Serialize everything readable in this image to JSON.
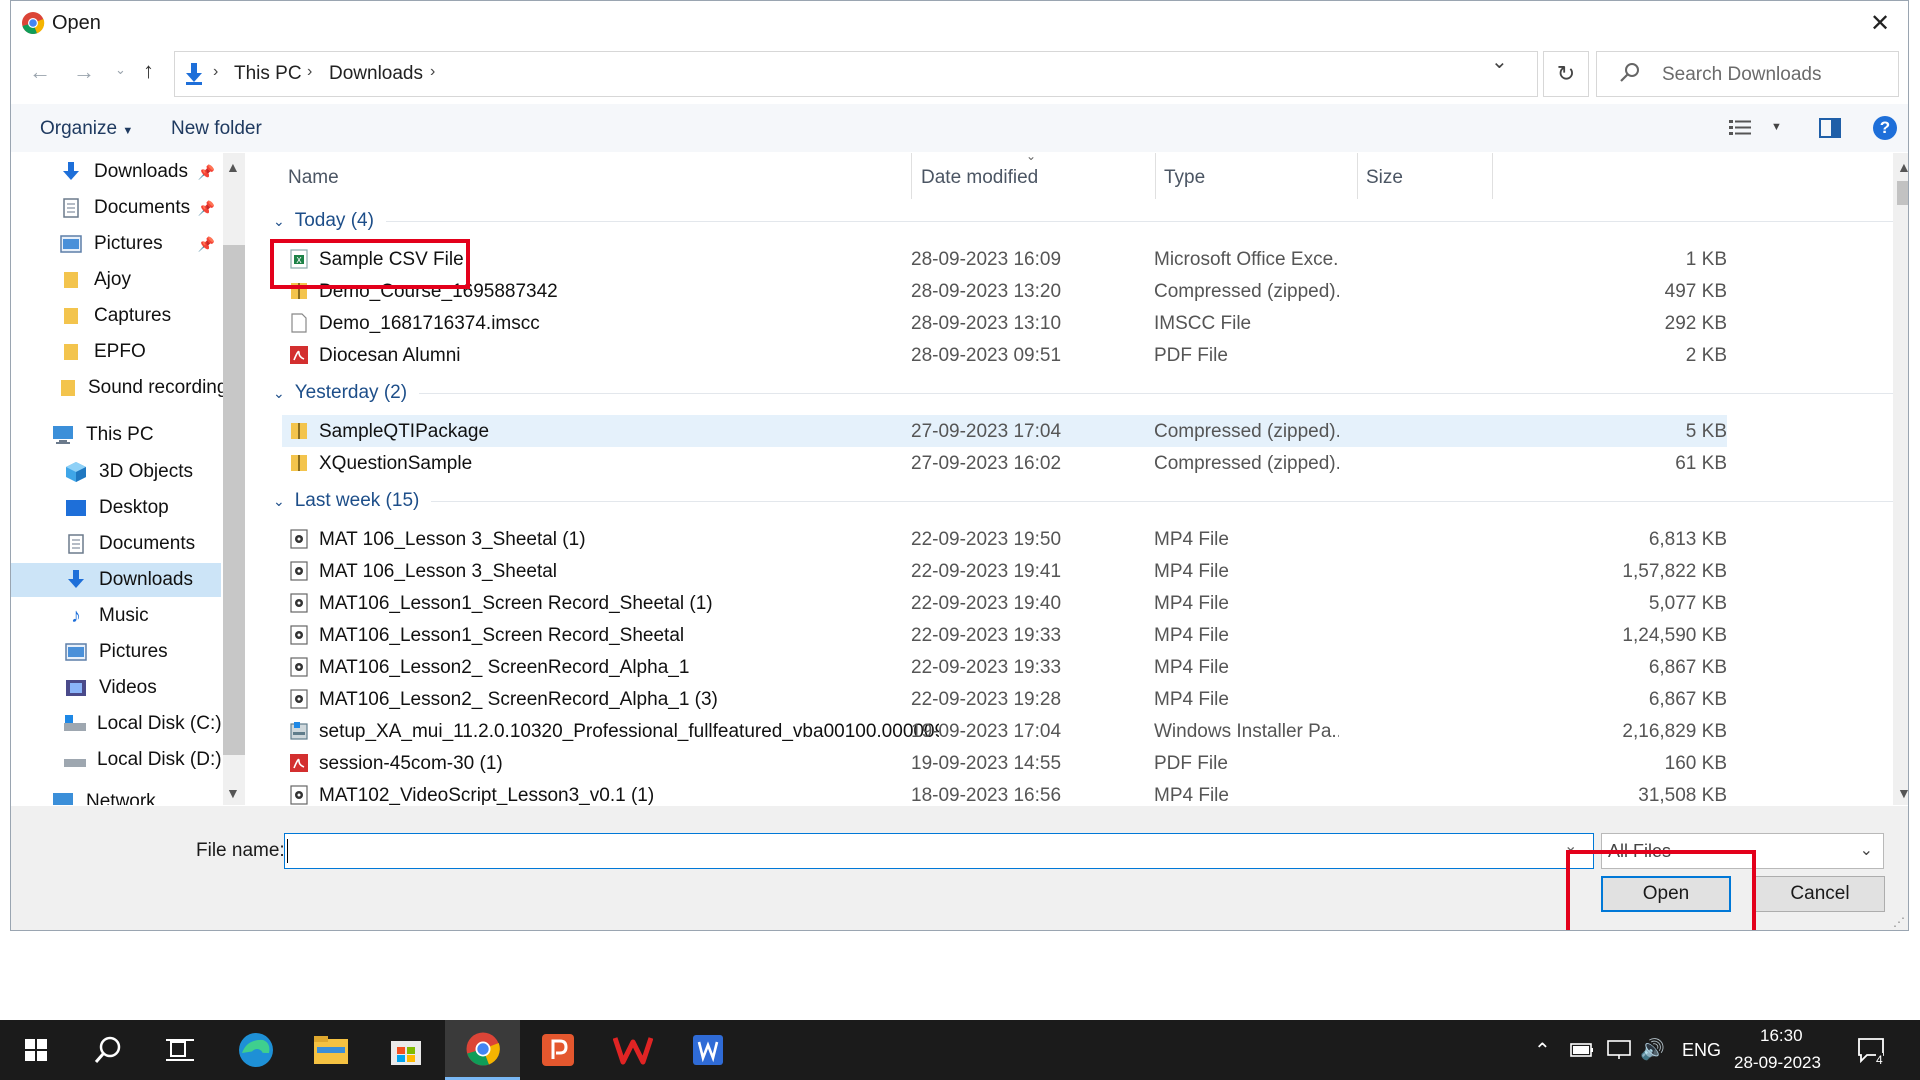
{
  "dialog": {
    "title": "Open",
    "close": "✕"
  },
  "address": {
    "crumbs": [
      "This PC",
      "Downloads"
    ],
    "search_placeholder": "Search Downloads"
  },
  "toolbar": {
    "organize": "Organize",
    "new_folder": "New folder",
    "help": "?"
  },
  "nav": {
    "items": [
      {
        "label": "Downloads",
        "icon": "download-arrow-icon",
        "pinned": true
      },
      {
        "label": "Documents",
        "icon": "document-icon",
        "pinned": true
      },
      {
        "label": "Pictures",
        "icon": "pictures-icon",
        "pinned": true
      },
      {
        "label": "Ajoy",
        "icon": "folder-icon"
      },
      {
        "label": "Captures",
        "icon": "folder-icon"
      },
      {
        "label": "EPFO",
        "icon": "folder-icon"
      },
      {
        "label": "Sound recording",
        "icon": "folder-icon"
      },
      {
        "label": "This PC",
        "icon": "pc-icon"
      },
      {
        "label": "3D Objects",
        "icon": "3d-objects-icon"
      },
      {
        "label": "Desktop",
        "icon": "desktop-icon"
      },
      {
        "label": "Documents",
        "icon": "document-icon"
      },
      {
        "label": "Downloads",
        "icon": "download-arrow-icon",
        "selected": true
      },
      {
        "label": "Music",
        "icon": "music-icon"
      },
      {
        "label": "Pictures",
        "icon": "pictures-icon"
      },
      {
        "label": "Videos",
        "icon": "videos-icon"
      },
      {
        "label": "Local Disk (C:)",
        "icon": "disk-icon"
      },
      {
        "label": "Local Disk (D:)",
        "icon": "disk-icon"
      },
      {
        "label": "Network",
        "icon": "network-icon"
      }
    ]
  },
  "columns": {
    "name": "Name",
    "date": "Date modified",
    "type": "Type",
    "size": "Size"
  },
  "groups": [
    {
      "label": "Today (4)",
      "files": [
        {
          "name": "Sample CSV File",
          "date": "28-09-2023 16:09",
          "type": "Microsoft Office Exce...",
          "size": "1 KB",
          "icon": "excel-csv-icon"
        },
        {
          "name": "Demo_Course_1695887342",
          "date": "28-09-2023 13:20",
          "type": "Compressed (zipped)...",
          "size": "497 KB",
          "icon": "zip-folder-icon"
        },
        {
          "name": "Demo_1681716374.imscc",
          "date": "28-09-2023 13:10",
          "type": "IMSCC File",
          "size": "292 KB",
          "icon": "blank-file-icon"
        },
        {
          "name": "Diocesan Alumni",
          "date": "28-09-2023 09:51",
          "type": "PDF File",
          "size": "2 KB",
          "icon": "pdf-icon"
        }
      ]
    },
    {
      "label": "Yesterday (2)",
      "files": [
        {
          "name": "SampleQTIPackage",
          "date": "27-09-2023 17:04",
          "type": "Compressed (zipped)...",
          "size": "5 KB",
          "icon": "zip-folder-icon",
          "highlight": true
        },
        {
          "name": "XQuestionSample",
          "date": "27-09-2023 16:02",
          "type": "Compressed (zipped)...",
          "size": "61 KB",
          "icon": "zip-folder-icon"
        }
      ]
    },
    {
      "label": "Last week (15)",
      "files": [
        {
          "name": "MAT 106_Lesson 3_Sheetal (1)",
          "date": "22-09-2023 19:50",
          "type": "MP4 File",
          "size": "6,813 KB",
          "icon": "video-file-icon"
        },
        {
          "name": "MAT 106_Lesson 3_Sheetal",
          "date": "22-09-2023 19:41",
          "type": "MP4 File",
          "size": "1,57,822 KB",
          "icon": "video-file-icon"
        },
        {
          "name": "MAT106_Lesson1_Screen Record_Sheetal (1)",
          "date": "22-09-2023 19:40",
          "type": "MP4 File",
          "size": "5,077 KB",
          "icon": "video-file-icon"
        },
        {
          "name": "MAT106_Lesson1_Screen Record_Sheetal",
          "date": "22-09-2023 19:33",
          "type": "MP4 File",
          "size": "1,24,590 KB",
          "icon": "video-file-icon"
        },
        {
          "name": "MAT106_Lesson2_ ScreenRecord_Alpha_1",
          "date": "22-09-2023 19:33",
          "type": "MP4 File",
          "size": "6,867 KB",
          "icon": "video-file-icon"
        },
        {
          "name": "MAT106_Lesson2_ ScreenRecord_Alpha_1 (3)",
          "date": "22-09-2023 19:28",
          "type": "MP4 File",
          "size": "6,867 KB",
          "icon": "video-file-icon"
        },
        {
          "name": "setup_XA_mui_11.2.0.10320_Professional_fullfeatured_vba00100.000009...",
          "date": "19-09-2023 17:04",
          "type": "Windows Installer Pa...",
          "size": "2,16,829 KB",
          "icon": "installer-icon"
        },
        {
          "name": "session-45com-30 (1)",
          "date": "19-09-2023 14:55",
          "type": "PDF File",
          "size": "160 KB",
          "icon": "pdf-icon"
        },
        {
          "name": "MAT102_VideoScript_Lesson3_v0.1 (1)",
          "date": "18-09-2023 16:56",
          "type": "MP4 File",
          "size": "31,508 KB",
          "icon": "video-file-icon"
        }
      ]
    }
  ],
  "bottom": {
    "filename_label": "File name:",
    "filename_value": "",
    "filter_value": "All Files",
    "open": "Open",
    "cancel": "Cancel"
  },
  "taskbar": {
    "apps": [
      "start-icon",
      "search-icon",
      "task-view-icon",
      "edge-icon",
      "file-explorer-icon",
      "store-icon",
      "chrome-icon",
      "powerpoint-icon",
      "wps-icon",
      "word-icon"
    ],
    "active_app": "chrome-icon",
    "lang": "ENG",
    "time": "16:30",
    "date": "28-09-2023",
    "notification_count": "4"
  },
  "colors": {
    "accent": "#0078d7",
    "selection": "#cce4f7",
    "annotation": "#e3001b",
    "group_header": "#1d4e89"
  }
}
